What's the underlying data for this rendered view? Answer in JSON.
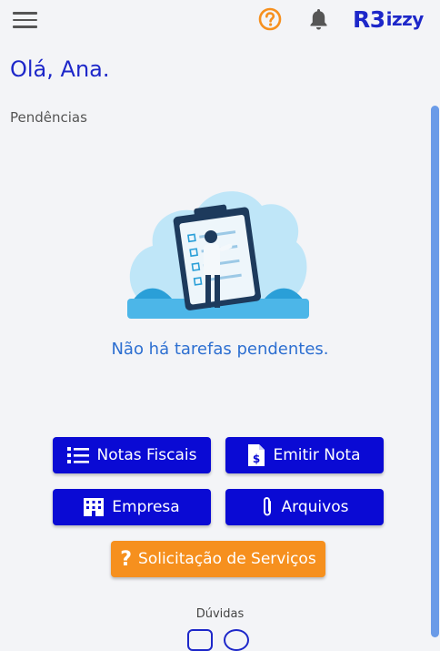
{
  "header": {
    "menu_icon": "hamburger-icon",
    "help_icon": "question-circle-icon",
    "notification_icon": "bell-icon",
    "logo": {
      "part1": "R3",
      "part2": "izzy"
    },
    "colors": {
      "brand": "#1d27c9",
      "help": "#f6901e"
    }
  },
  "greeting": "Olá, Ana.",
  "pendencias": {
    "label": "Pendências",
    "empty_message": "Não há tarefas pendentes."
  },
  "actions": [
    {
      "label": "Notas Fiscais",
      "icon": "list-icon"
    },
    {
      "label": "Emitir Nota",
      "icon": "invoice-dollar-icon"
    },
    {
      "label": "Empresa",
      "icon": "building-icon"
    },
    {
      "label": "Arquivos",
      "icon": "paperclip-icon"
    }
  ],
  "service_request": {
    "label": "Solicitação de Serviços",
    "icon_text": "?"
  },
  "footer": {
    "label": "Dúvidas"
  },
  "colors": {
    "primary_button": "#0a0ad4",
    "accent_button": "#f6901e",
    "link_text": "#2d6fd1"
  }
}
